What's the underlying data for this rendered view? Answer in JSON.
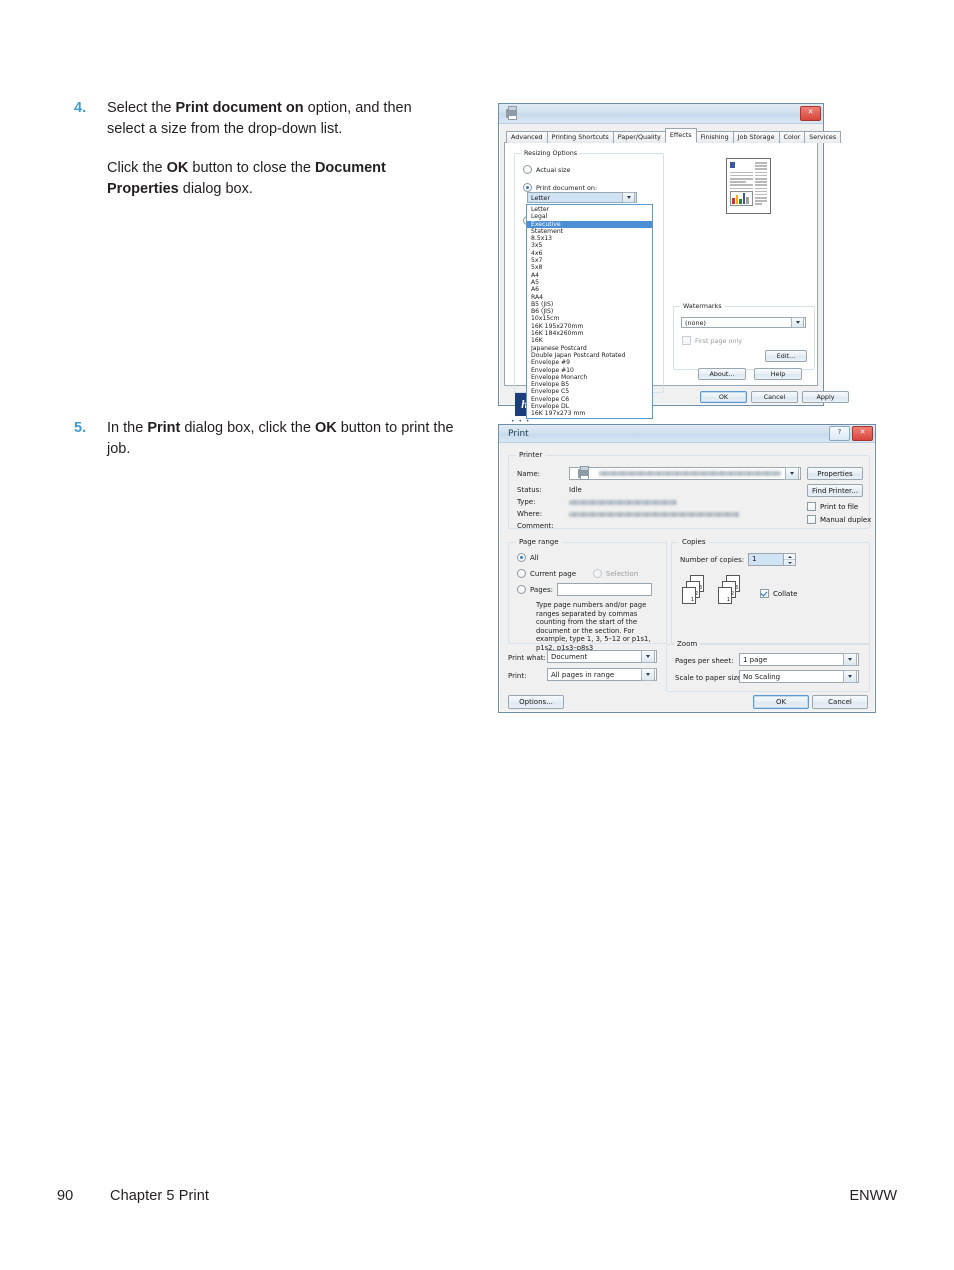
{
  "document": {
    "steps": [
      {
        "number": "4.",
        "paragraphs": [
          "Select the |Print document on| option, and then select a size from the drop-down list.",
          "Click the |OK| button to close the |Document Properties| dialog box."
        ]
      },
      {
        "number": "5.",
        "paragraphs": [
          "In the |Print| dialog box, click the |OK| button to print the job."
        ]
      }
    ],
    "step4": {
      "number": "4.",
      "p1_a": "Select the ",
      "p1_b": "Print document on",
      "p1_c": " option, and then select a size from the drop-down list.",
      "p2_a": "Click the ",
      "p2_b": "OK",
      "p2_c": " button to close the ",
      "p2_d": "Document Properties",
      "p2_e": " dialog box."
    },
    "step5": {
      "number": "5.",
      "p1_a": "In the ",
      "p1_b": "Print",
      "p1_c": " dialog box, click the ",
      "p1_d": "OK",
      "p1_e": " button to print the job."
    },
    "footer": {
      "page_number": "90",
      "chapter": "Chapter 5   Print",
      "brand": "ENWW"
    },
    "colors": {
      "step_number": "#3f9ed5",
      "body_text": "#231f20"
    }
  },
  "doc_properties_dialog": {
    "title": "",
    "title_icon": "printer-icon",
    "close_label": "✕",
    "tabs": [
      {
        "label": "Advanced",
        "active": false
      },
      {
        "label": "Printing Shortcuts",
        "active": false
      },
      {
        "label": "Paper/Quality",
        "active": false
      },
      {
        "label": "Effects",
        "active": true
      },
      {
        "label": "Finishing",
        "active": false
      },
      {
        "label": "Job Storage",
        "active": false
      },
      {
        "label": "Color",
        "active": false
      },
      {
        "label": "Services",
        "active": false
      }
    ],
    "resizing_options": {
      "group_label": "Resizing Options",
      "actual_size_label": "Actual size",
      "actual_size_selected": false,
      "print_document_on_label": "Print document on:",
      "print_document_on_selected": true,
      "combo_value": "Letter",
      "statement_label": "Statement",
      "options": [
        {
          "label": "Letter",
          "selected": false
        },
        {
          "label": "Legal",
          "selected": false
        },
        {
          "label": "Executive",
          "selected": true
        },
        {
          "label": "Statement",
          "selected": false
        },
        {
          "label": "8.5x13",
          "selected": false
        },
        {
          "label": "3x5",
          "selected": false
        },
        {
          "label": "4x6",
          "selected": false
        },
        {
          "label": "5x7",
          "selected": false
        },
        {
          "label": "5x8",
          "selected": false
        },
        {
          "label": "A4",
          "selected": false
        },
        {
          "label": "A5",
          "selected": false
        },
        {
          "label": "A6",
          "selected": false
        },
        {
          "label": "RA4",
          "selected": false
        },
        {
          "label": "B5 (JIS)",
          "selected": false
        },
        {
          "label": "B6 (JIS)",
          "selected": false
        },
        {
          "label": "10x15cm",
          "selected": false
        },
        {
          "label": "16K 195x270mm",
          "selected": false
        },
        {
          "label": "16K 184x260mm",
          "selected": false
        },
        {
          "label": "16K",
          "selected": false
        },
        {
          "label": "Japanese Postcard",
          "selected": false
        },
        {
          "label": "Double Japan Postcard Rotated",
          "selected": false
        },
        {
          "label": "Envelope #9",
          "selected": false
        },
        {
          "label": "Envelope #10",
          "selected": false
        },
        {
          "label": "Envelope Monarch",
          "selected": false
        },
        {
          "label": "Envelope B5",
          "selected": false
        },
        {
          "label": "Envelope C5",
          "selected": false
        },
        {
          "label": "Envelope C6",
          "selected": false
        },
        {
          "label": "Envelope DL",
          "selected": false
        },
        {
          "label": "16K 197x273 mm",
          "selected": false
        }
      ]
    },
    "watermarks": {
      "group_label": "Watermarks",
      "combo_value": "(none)",
      "first_page_only_label": "First page only",
      "first_page_only_checked": false,
      "edit_button": "Edit..."
    },
    "logo_text": "hp",
    "logo_dots": "• • •",
    "buttons": {
      "about": "About...",
      "help": "Help",
      "ok": "OK",
      "cancel": "Cancel",
      "apply": "Apply"
    }
  },
  "print_dialog": {
    "title": "Print",
    "help_label": "?",
    "close_label": "✕",
    "printer": {
      "group_label": "Printer",
      "name_label": "Name:",
      "name_value": "",
      "properties_button": "Properties",
      "status_label": "Status:",
      "status_value": "Idle",
      "type_label": "Type:",
      "type_value": "",
      "where_label": "Where:",
      "where_value": "",
      "comment_label": "Comment:",
      "comment_value": "",
      "find_printer_button": "Find Printer...",
      "print_to_file_label": "Print to file",
      "print_to_file_checked": false,
      "manual_duplex_label": "Manual duplex",
      "manual_duplex_checked": false
    },
    "page_range": {
      "group_label": "Page range",
      "all_label": "All",
      "all_selected": true,
      "current_page_label": "Current page",
      "current_page_selected": false,
      "selection_label": "Selection",
      "selection_selected": false,
      "selection_disabled": true,
      "pages_label": "Pages:",
      "pages_value": "",
      "help_text": "Type page numbers and/or page ranges separated by commas counting from the start of the document or the section. For example, type 1, 3, 5–12 or p1s1, p1s2, p1s3–p8s3"
    },
    "copies": {
      "group_label": "Copies",
      "number_label": "Number of copies:",
      "number_value": "1",
      "collate_label": "Collate",
      "collate_checked": true,
      "sheet_numbers": [
        "3",
        "2",
        "1"
      ]
    },
    "print_what": {
      "label": "Print what:",
      "value": "Document"
    },
    "print_range": {
      "label": "Print:",
      "value": "All pages in range"
    },
    "zoom": {
      "group_label": "Zoom",
      "pages_per_sheet_label": "Pages per sheet:",
      "pages_per_sheet_value": "1 page",
      "scale_label": "Scale to paper size:",
      "scale_value": "No Scaling"
    },
    "buttons": {
      "options": "Options...",
      "ok": "OK",
      "cancel": "Cancel"
    }
  }
}
